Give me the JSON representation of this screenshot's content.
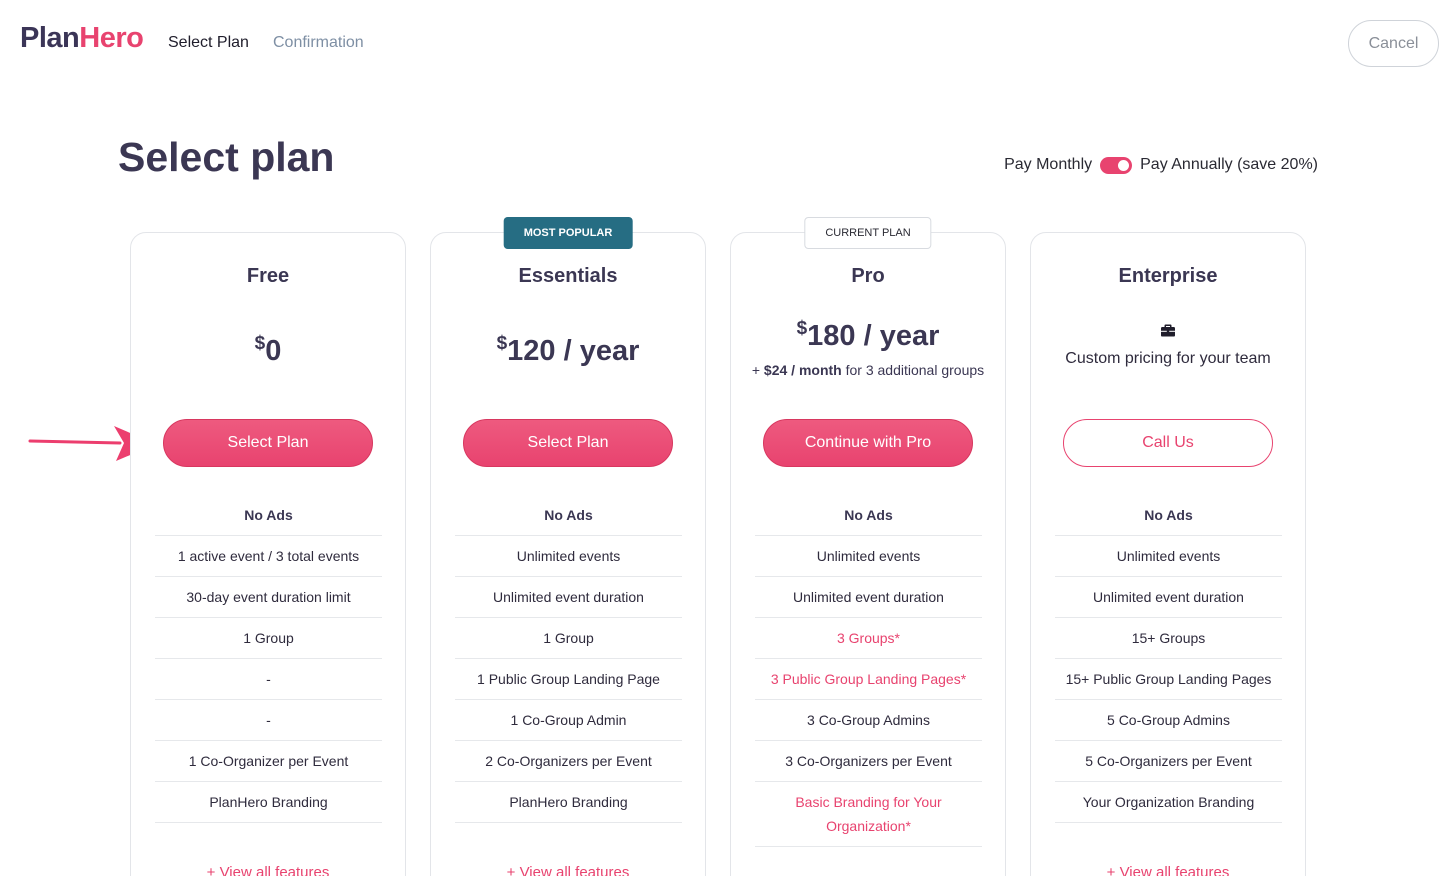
{
  "header": {
    "logo_part1": "Plan",
    "logo_part2": "Hero",
    "steps": [
      "Select Plan",
      "Confirmation"
    ],
    "cancel_label": "Cancel"
  },
  "page": {
    "title": "Select plan",
    "billing": {
      "monthly_label": "Pay Monthly",
      "annual_label": "Pay Annually (save 20%)",
      "annual_selected": true
    }
  },
  "plans": [
    {
      "name": "Free",
      "currency": "$",
      "price": "0",
      "cta": "Select Plan",
      "features": [
        "No Ads",
        "1 active event / 3 total events",
        "30-day event duration limit",
        "1 Group",
        "-",
        "-",
        "1 Co-Organizer per Event",
        "PlanHero Branding"
      ],
      "view_all": "+ View all features"
    },
    {
      "name": "Essentials",
      "badge": "MOST POPULAR",
      "currency": "$",
      "price": "120 / year",
      "cta": "Select Plan",
      "features": [
        "No Ads",
        "Unlimited events",
        "Unlimited event duration",
        "1 Group",
        "1 Public Group Landing Page",
        "1 Co-Group Admin",
        "2 Co-Organizers per Event",
        "PlanHero Branding"
      ],
      "view_all": "+ View all features"
    },
    {
      "name": "Pro",
      "badge": "CURRENT PLAN",
      "currency": "$",
      "price": "180 / year",
      "note_prefix": "+ ",
      "note_bold": "$24 / month",
      "note_suffix": " for 3 additional groups",
      "cta": "Continue with Pro",
      "features": [
        "No Ads",
        "Unlimited events",
        "Unlimited event duration",
        "3 Groups*",
        "3 Public Group Landing Pages*",
        "3 Co-Group Admins",
        "3 Co-Organizers per Event",
        "Basic Branding for Your Organization*"
      ]
    },
    {
      "name": "Enterprise",
      "icon": "briefcase-icon",
      "custom_text": "Custom pricing for your team",
      "cta": "Call Us",
      "features": [
        "No Ads",
        "Unlimited events",
        "Unlimited event duration",
        "15+ Groups",
        "15+ Public Group Landing Pages",
        "5 Co-Group Admins",
        "5 Co-Organizers per Event",
        "Your Organization Branding"
      ],
      "view_all": "+ View all features"
    }
  ],
  "colors": {
    "accent": "#e8436f",
    "badge_popular": "#266d83",
    "title": "#3b3753"
  }
}
